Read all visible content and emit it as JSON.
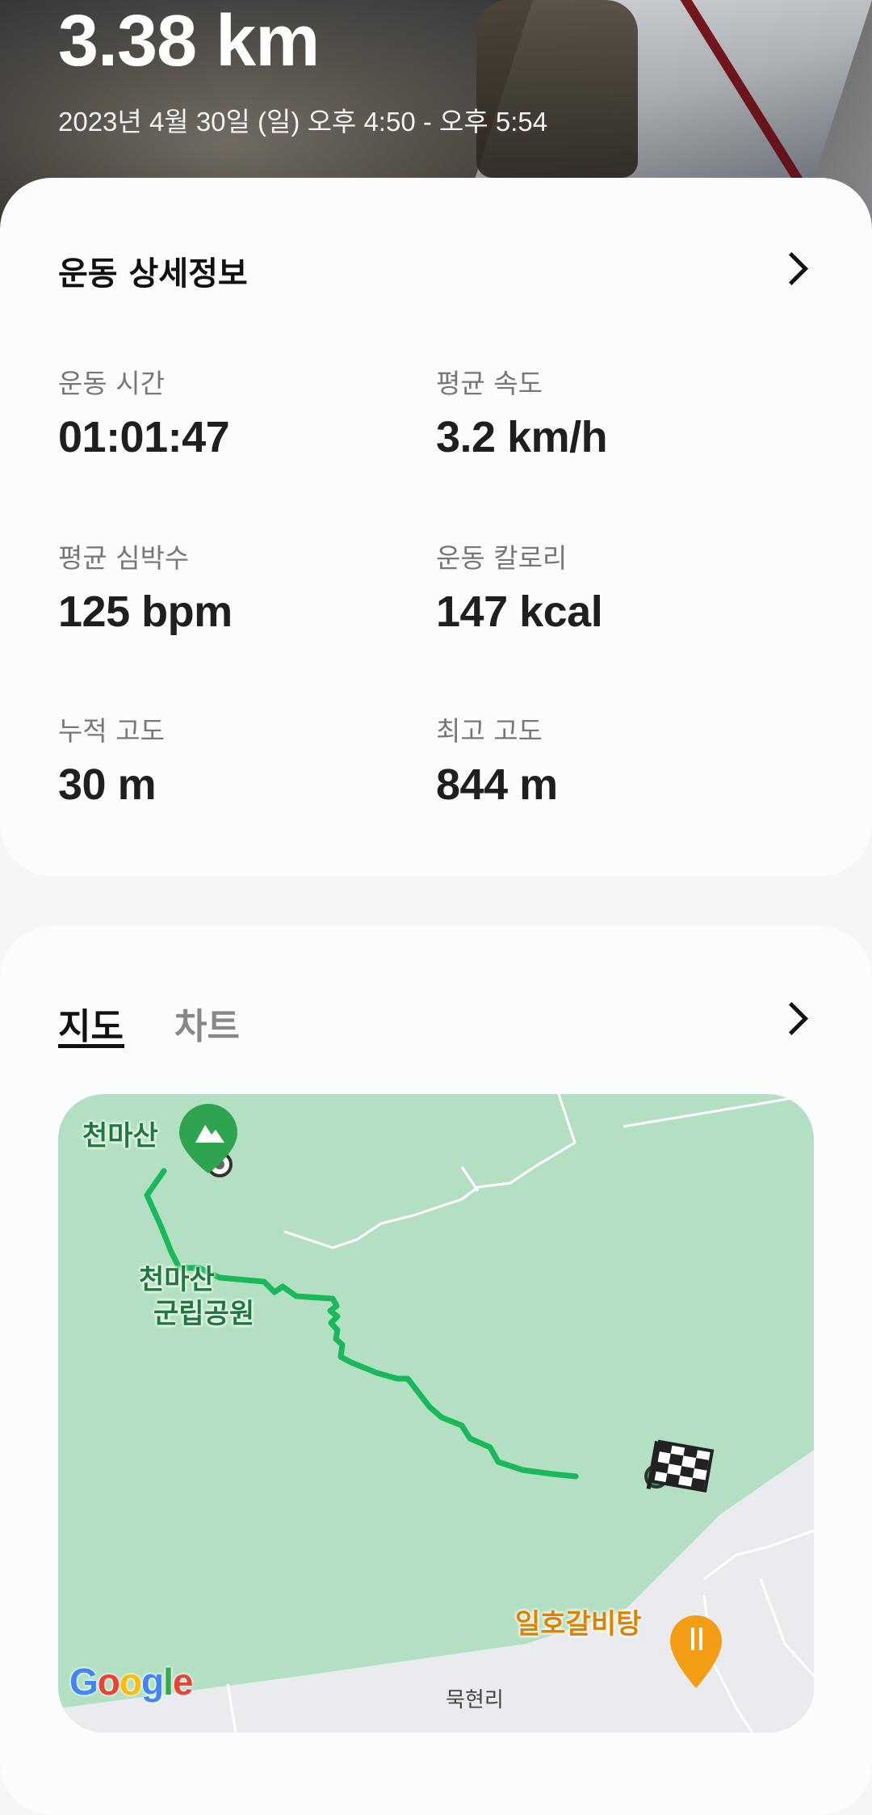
{
  "hero": {
    "distance": "3.38 km",
    "datetime": "2023년 4월 30일 (일) 오후 4:50 - 오후 5:54"
  },
  "details": {
    "title": "운동 상세정보",
    "stats": [
      {
        "label": "운동 시간",
        "value": "01:01:47"
      },
      {
        "label": "평균 속도",
        "value": "3.2 km/h"
      },
      {
        "label": "평균 심박수",
        "value": "125 bpm"
      },
      {
        "label": "운동 칼로리",
        "value": "147 kcal"
      },
      {
        "label": "누적 고도",
        "value": "30 m"
      },
      {
        "label": "최고 고도",
        "value": "844 m"
      }
    ]
  },
  "map_section": {
    "tabs": [
      {
        "label": "지도",
        "active": true
      },
      {
        "label": "차트",
        "active": false
      }
    ],
    "map": {
      "labels": {
        "peak": "천마산",
        "park_line1": "천마산",
        "park_line2": "군립공원",
        "restaurant": "일호갈비탕",
        "village": "묵현리"
      },
      "logo": "Google",
      "colors": {
        "park": "#b3e0c2",
        "route": "#19b85a",
        "road": "#e9ebee",
        "peak_marker": "#2fa44f",
        "restaurant_marker": "#f29d13"
      }
    }
  }
}
